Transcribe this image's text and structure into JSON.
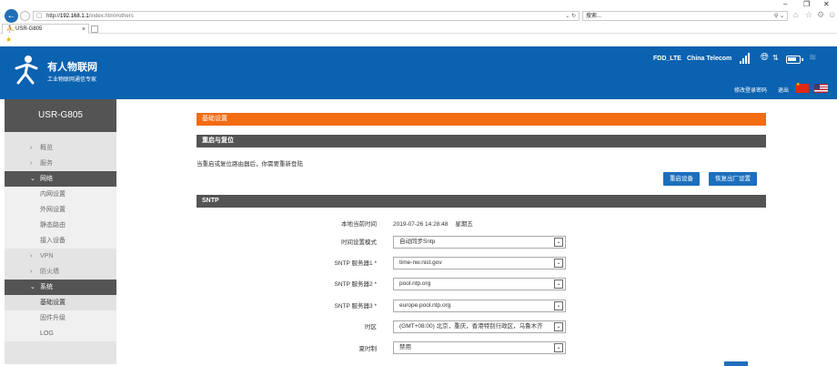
{
  "browser": {
    "url_scheme": "http://",
    "url_host": "192.168.1.1",
    "url_path": "/index.html#others",
    "search_placeholder": "搜索...",
    "tab_title": "USR-G805",
    "window_controls": [
      "–",
      "❐",
      "✕"
    ]
  },
  "header": {
    "brand_name": "有人物联网",
    "brand_sub": "工业物联网通信专家",
    "net_mode": "FDD_LTE",
    "carrier": "China Telecom",
    "change_password": "修改登录密码",
    "logout": "退出",
    "colors": {
      "header_bg": "#0b62b0",
      "accent_orange": "#f26c13",
      "button_blue": "#1d6fbd"
    }
  },
  "sidebar": {
    "title": "USR-G805",
    "items": [
      {
        "label": "概览",
        "chevron": "›"
      },
      {
        "label": "服务",
        "chevron": "›"
      },
      {
        "label": "网络",
        "chevron": "⌄",
        "open": true,
        "children": [
          "内网设置",
          "外网设置",
          "静态路由",
          "接入设备"
        ]
      },
      {
        "label": "VPN",
        "chevron": "›"
      },
      {
        "label": "防火墙",
        "chevron": "›"
      },
      {
        "label": "系统",
        "chevron": "⌄",
        "open": true,
        "children": [
          "基础设置",
          "固件升级",
          "LOG"
        ]
      }
    ]
  },
  "main": {
    "page_title": "基础设置",
    "restart_section": {
      "title": "重启与复位",
      "note": "当重启或复位路由器后，你需要重新登陆",
      "restart_button": "重启设备",
      "factory_reset_button": "恢复出厂设置"
    },
    "sntp_section": {
      "title": "SNTP",
      "local_time_label": "本地当前时间",
      "local_time_value": "2019-07-26 14:28:48",
      "local_weekday": "星期五",
      "fields": [
        {
          "label": "时间设置模式",
          "value": "自动同步Sntp"
        },
        {
          "label": "SNTP 服务器1 *",
          "value": "time-nw.nist.gov"
        },
        {
          "label": "SNTP 服务器2 *",
          "value": "pool.ntp.org"
        },
        {
          "label": "SNTP 服务器3 *",
          "value": "europe.pool.ntp.org"
        },
        {
          "label": "时区",
          "value": "(GMT+08:00) 北京，重庆，香港特别行政区，乌鲁木齐"
        },
        {
          "label": "夏时制",
          "value": "禁用"
        }
      ]
    }
  }
}
